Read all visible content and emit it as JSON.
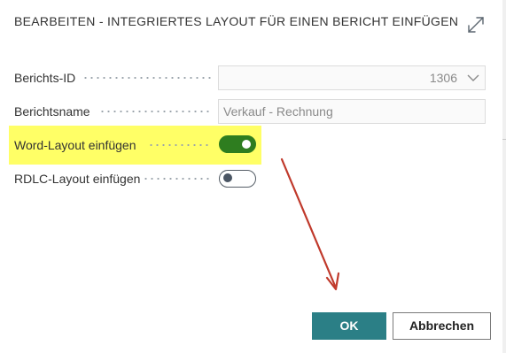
{
  "dialog": {
    "title": "BEARBEITEN - INTEGRIERTES LAYOUT FÜR EINEN BERICHT EINFÜGEN",
    "expand_icon": "expand-diagonal-icon"
  },
  "fields": {
    "report_id": {
      "label": "Berichts-ID",
      "value": "1306"
    },
    "report_name": {
      "label": "Berichtsname",
      "value": "Verkauf - Rechnung"
    },
    "word_layout": {
      "label": "Word-Layout einfügen",
      "state": "on"
    },
    "rdlc_layout": {
      "label": "RDLC-Layout einfügen",
      "state": "off"
    }
  },
  "annotations": {
    "highlight_color": "#ffff66",
    "arrow_color": "#c0392b"
  },
  "buttons": {
    "ok_label": "OK",
    "cancel_label": "Abbrechen"
  },
  "colors": {
    "toggle_on": "#2e7d1f",
    "ok_button": "#2b7f86"
  }
}
